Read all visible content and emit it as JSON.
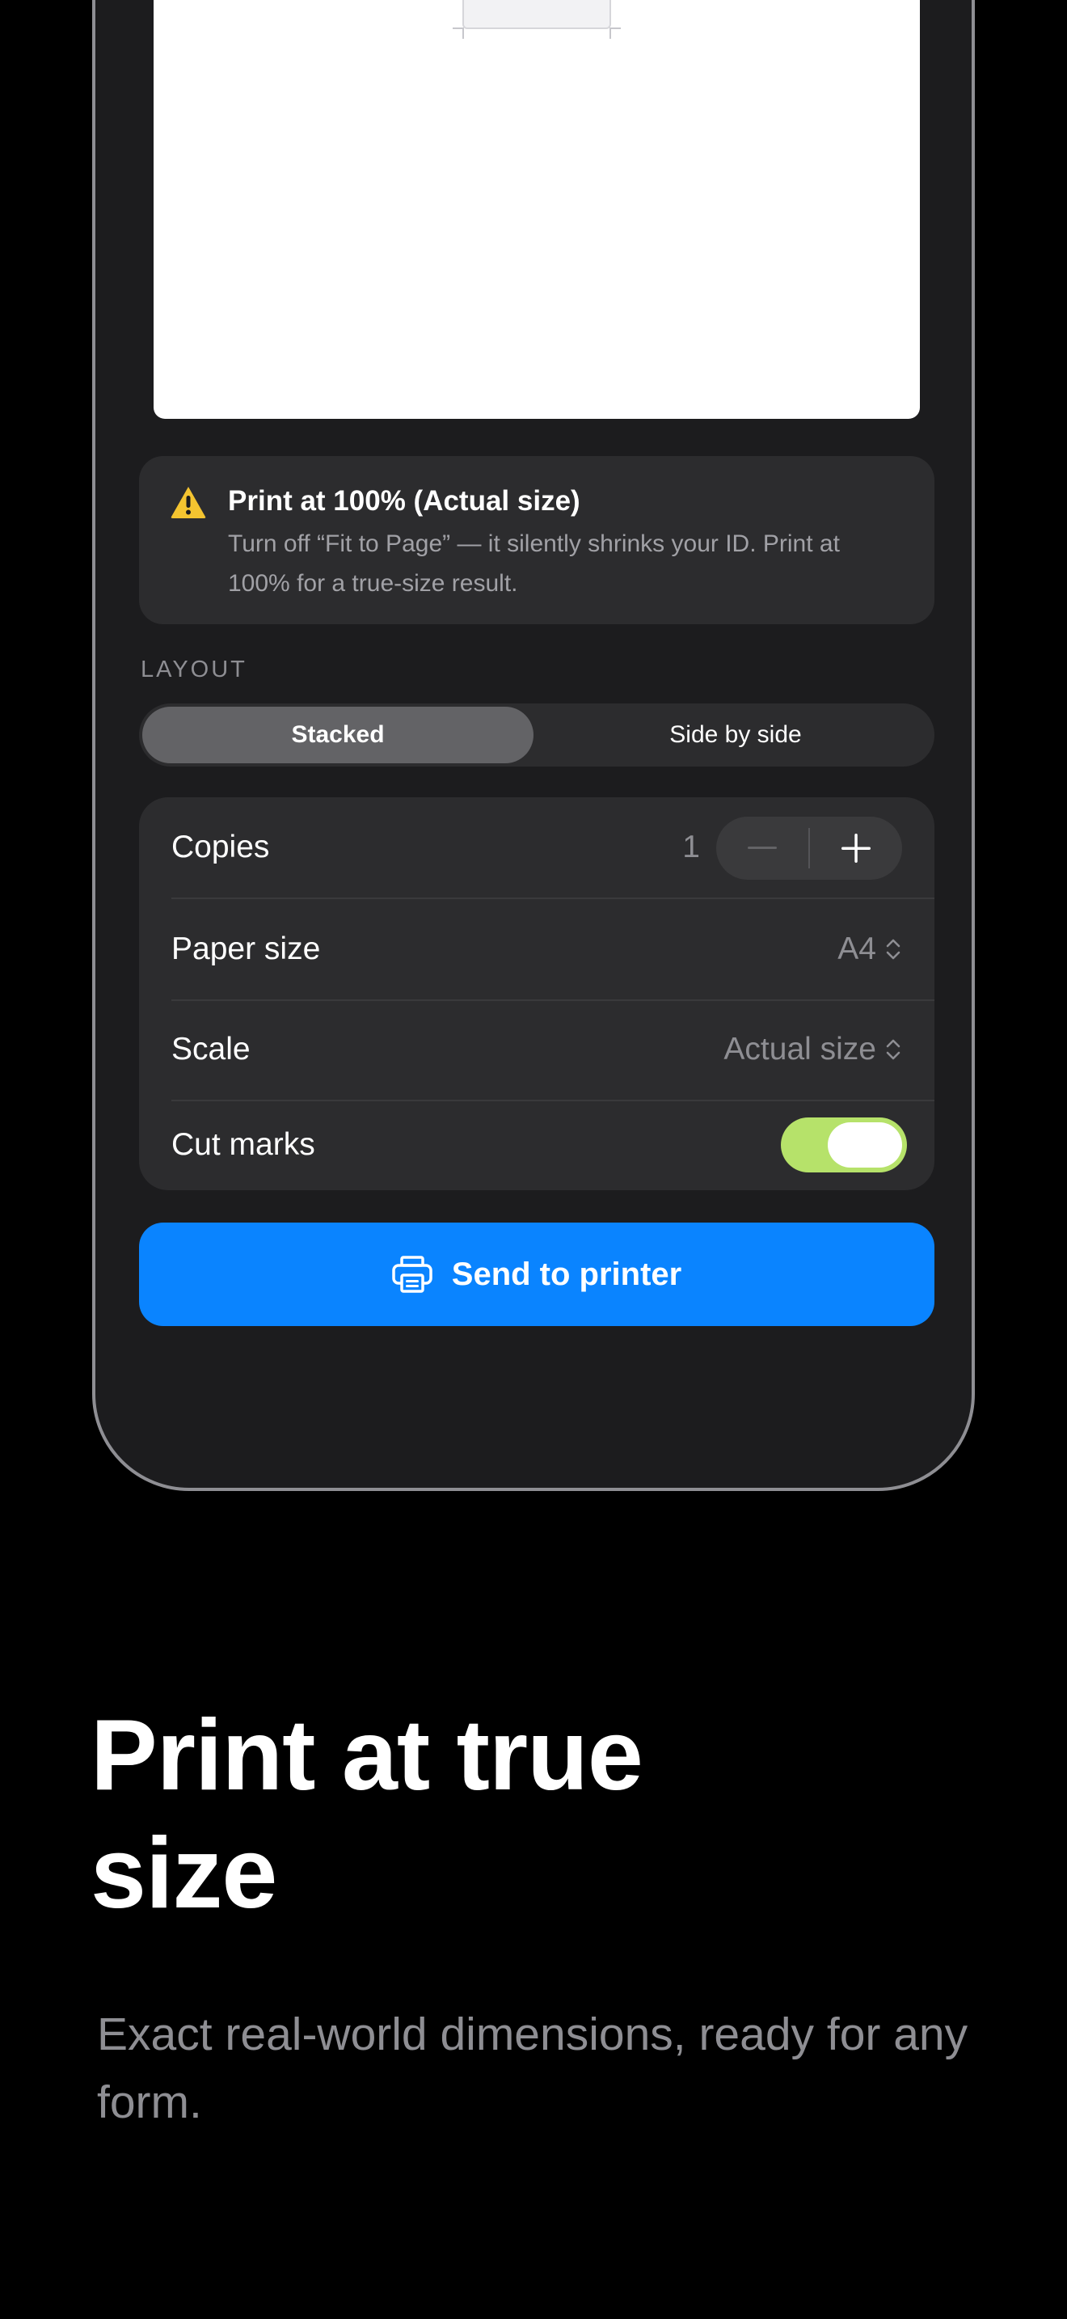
{
  "warning": {
    "title": "Print at 100% (Actual size)",
    "body": "Turn off “Fit to Page” — it silently shrinks your ID. Print at 100% for a true-size result.",
    "icon": "warning-triangle-icon",
    "icon_color": "#f4c430"
  },
  "layout": {
    "label": "LAYOUT",
    "options": [
      "Stacked",
      "Side by side"
    ],
    "selected": "Stacked"
  },
  "settings": {
    "copies": {
      "label": "Copies",
      "value": "1",
      "minus": "−",
      "plus": "+"
    },
    "paper_size": {
      "label": "Paper size",
      "value": "A4"
    },
    "scale": {
      "label": "Scale",
      "value": "Actual size"
    },
    "cut_marks": {
      "label": "Cut marks",
      "enabled": true
    }
  },
  "send_button": {
    "label": "Send to printer",
    "icon": "printer-icon"
  },
  "marketing": {
    "headline_line1": "Print at true",
    "headline_line2": "size",
    "subtitle": "Exact real-world dimensions, ready for any form."
  },
  "colors": {
    "accent": "#0a84ff",
    "toggle_on": "#b6e26a",
    "background": "#000000",
    "card": "#2c2c2e"
  }
}
